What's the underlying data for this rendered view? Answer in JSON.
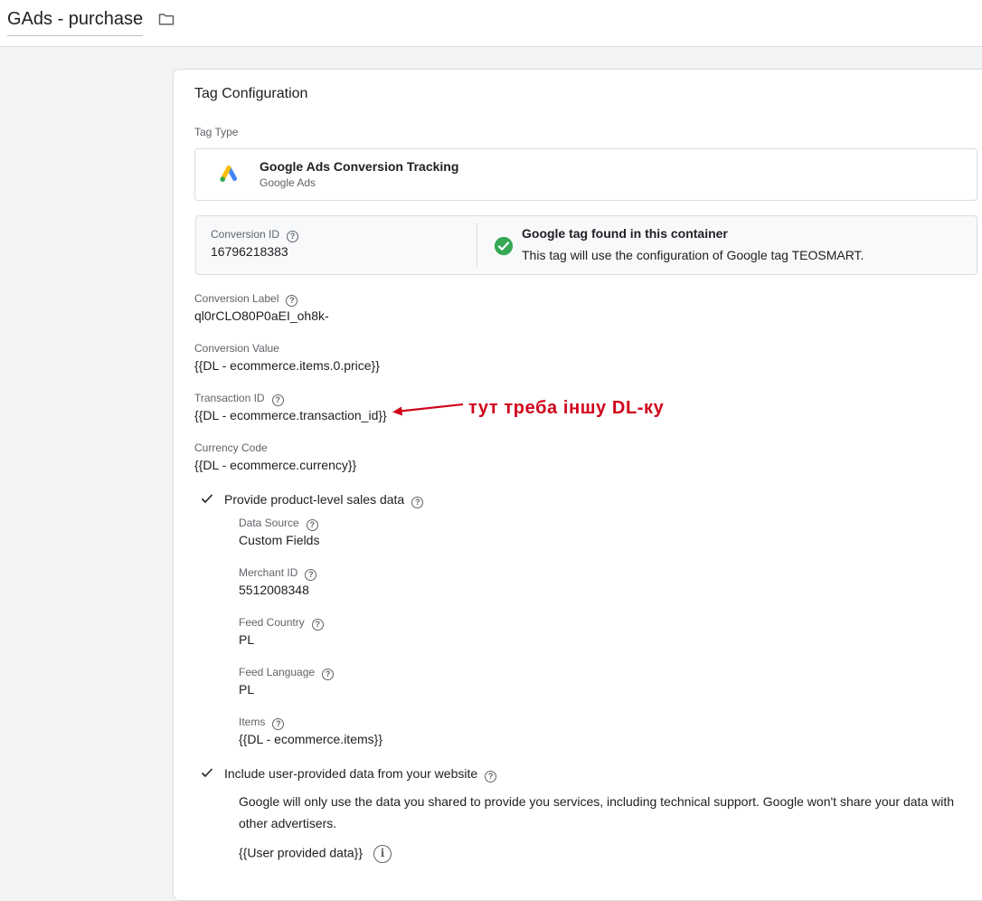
{
  "header": {
    "tag_name": "GAds - purchase"
  },
  "card": {
    "title": "Tag Configuration",
    "tag_type_label": "Tag Type",
    "tag_type": {
      "name": "Google Ads Conversion Tracking",
      "provider": "Google Ads"
    },
    "conversion_id": {
      "label": "Conversion ID",
      "value": "16796218383"
    },
    "google_tag": {
      "title": "Google tag found in this container",
      "description": "This tag will use the configuration of Google tag TEOSMART."
    },
    "conversion_label": {
      "label": "Conversion Label",
      "value": "ql0rCLO80P0aEI_oh8k-"
    },
    "conversion_value": {
      "label": "Conversion Value",
      "value": "{{DL - ecommerce.items.0.price}}"
    },
    "transaction_id": {
      "label": "Transaction ID",
      "value": "{{DL - ecommerce.transaction_id}}"
    },
    "currency_code": {
      "label": "Currency Code",
      "value": "{{DL - ecommerce.currency}}"
    },
    "product_level": {
      "label": "Provide product-level sales data",
      "data_source": {
        "label": "Data Source",
        "value": "Custom Fields"
      },
      "merchant_id": {
        "label": "Merchant ID",
        "value": "5512008348"
      },
      "feed_country": {
        "label": "Feed Country",
        "value": "PL"
      },
      "feed_language": {
        "label": "Feed Language",
        "value": "PL"
      },
      "items": {
        "label": "Items",
        "value": "{{DL - ecommerce.items}}"
      }
    },
    "user_data": {
      "label": "Include user-provided data from your website",
      "notice_line1": "Google will only use the data you shared to provide you services, including technical support. Google won't share your data with",
      "notice_line2": "other advertisers.",
      "variable": "{{User provided data}}"
    }
  },
  "annotation": {
    "text": "тут треба іншу DL-ку",
    "color": "#d0021b"
  },
  "icons": {
    "folder": "folder-icon",
    "google_ads": "google-ads-logo-icon",
    "help": "help-circle-icon",
    "check": "check-icon",
    "success": "check-circle-icon",
    "info": "info-icon"
  },
  "colors": {
    "success_green": "#34a853",
    "muted_text": "#5f6368",
    "border": "#dadce0"
  }
}
